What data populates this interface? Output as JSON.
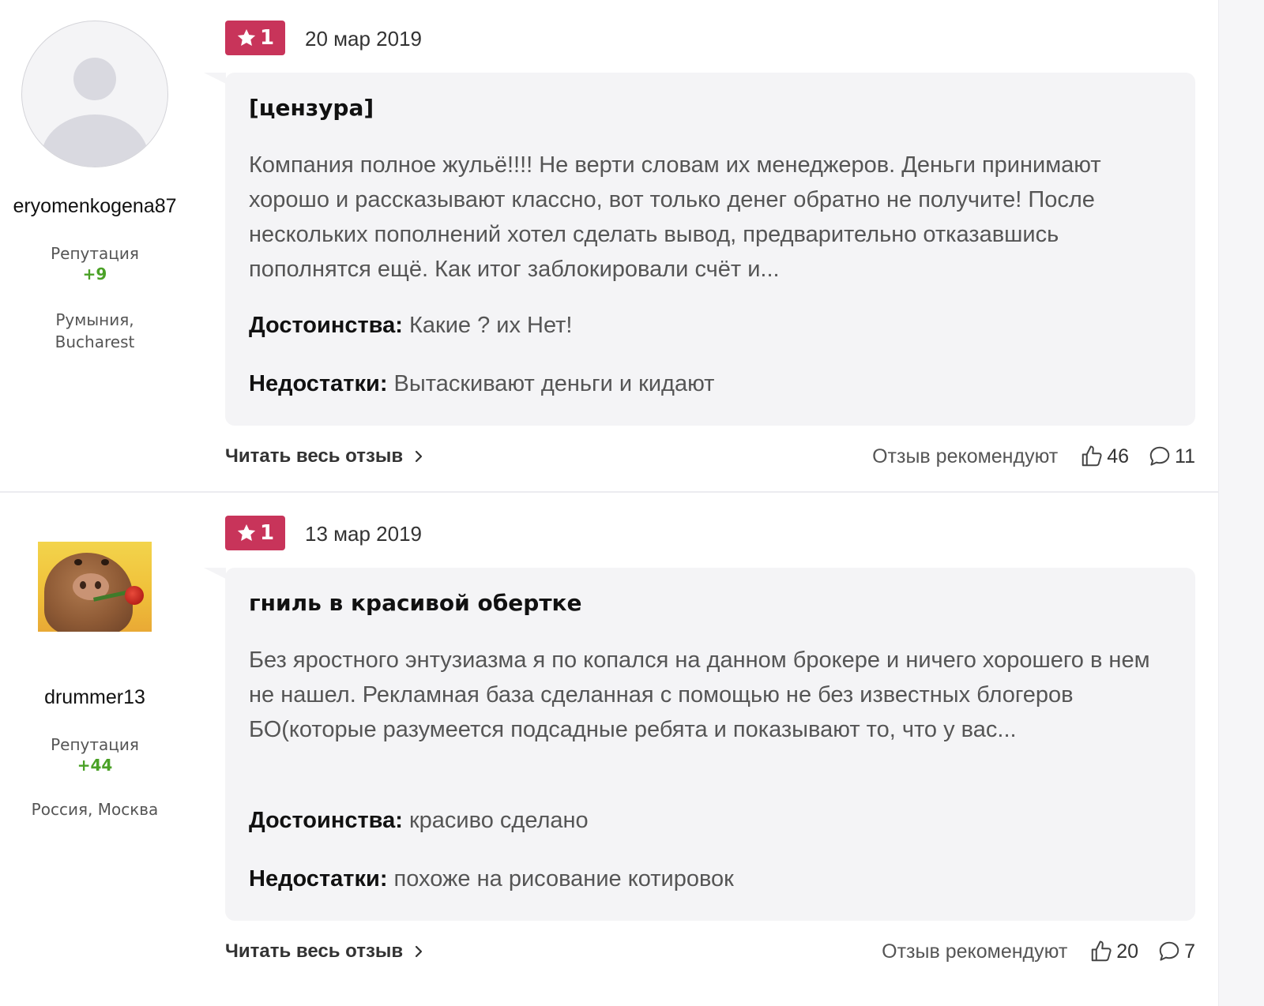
{
  "reviews": [
    {
      "author": {
        "username": "eryomenkogena87",
        "reputation_label": "Репутация",
        "reputation_value": "+9",
        "location": "Румыния, Bucharest",
        "avatar": "default-user-icon"
      },
      "rating": "1",
      "date": "20 мар 2019",
      "title": "[цензура]",
      "body": "Компания полное жульё!!!! Не верти словам их менеджеров. Деньги принимают хорошо и рассказывают классно, вот только денег обратно не получите! После нескольких пополнений хотел сделать вывод, предварительно отказавшись пополнятся ещё. Как итог заблокировали счёт и...",
      "pros_label": "Достоинства:",
      "pros": "Какие ? их Нет!",
      "cons_label": "Недостатки:",
      "cons": "Вытаскивают деньги и кидают",
      "read_more": "Читать весь отзыв",
      "recommend_label": "Отзыв рекомендуют",
      "likes": "46",
      "comments": "11"
    },
    {
      "author": {
        "username": "drummer13",
        "reputation_label": "Репутация",
        "reputation_value": "+44",
        "location": "Россия, Москва",
        "avatar": "photo-avatar"
      },
      "rating": "1",
      "date": "13 мар 2019",
      "title": "гниль в красивой обертке",
      "body": "Без яростного энтузиазма я по копался на данном брокере и ничего хорошего в нем не нашел. Рекламная база сделанная с помощью не без известных блогеров БО(которые разумеется подсадные ребята и показывают то, что у вас...",
      "pros_label": "Достоинства:",
      "pros": "красиво сделано",
      "cons_label": "Недостатки:",
      "cons": "похоже на рисование котировок",
      "read_more": "Читать весь отзыв",
      "recommend_label": "Отзыв рекомендуют",
      "likes": "20",
      "comments": "7"
    }
  ],
  "colors": {
    "badge": "#c8345a",
    "reputation": "#4aa126",
    "bubble": "#f4f4f6"
  },
  "icons": {
    "rating": "star-icon",
    "read_more": "chevron-right-icon",
    "likes": "thumbs-up-icon",
    "comments": "comment-icon"
  }
}
